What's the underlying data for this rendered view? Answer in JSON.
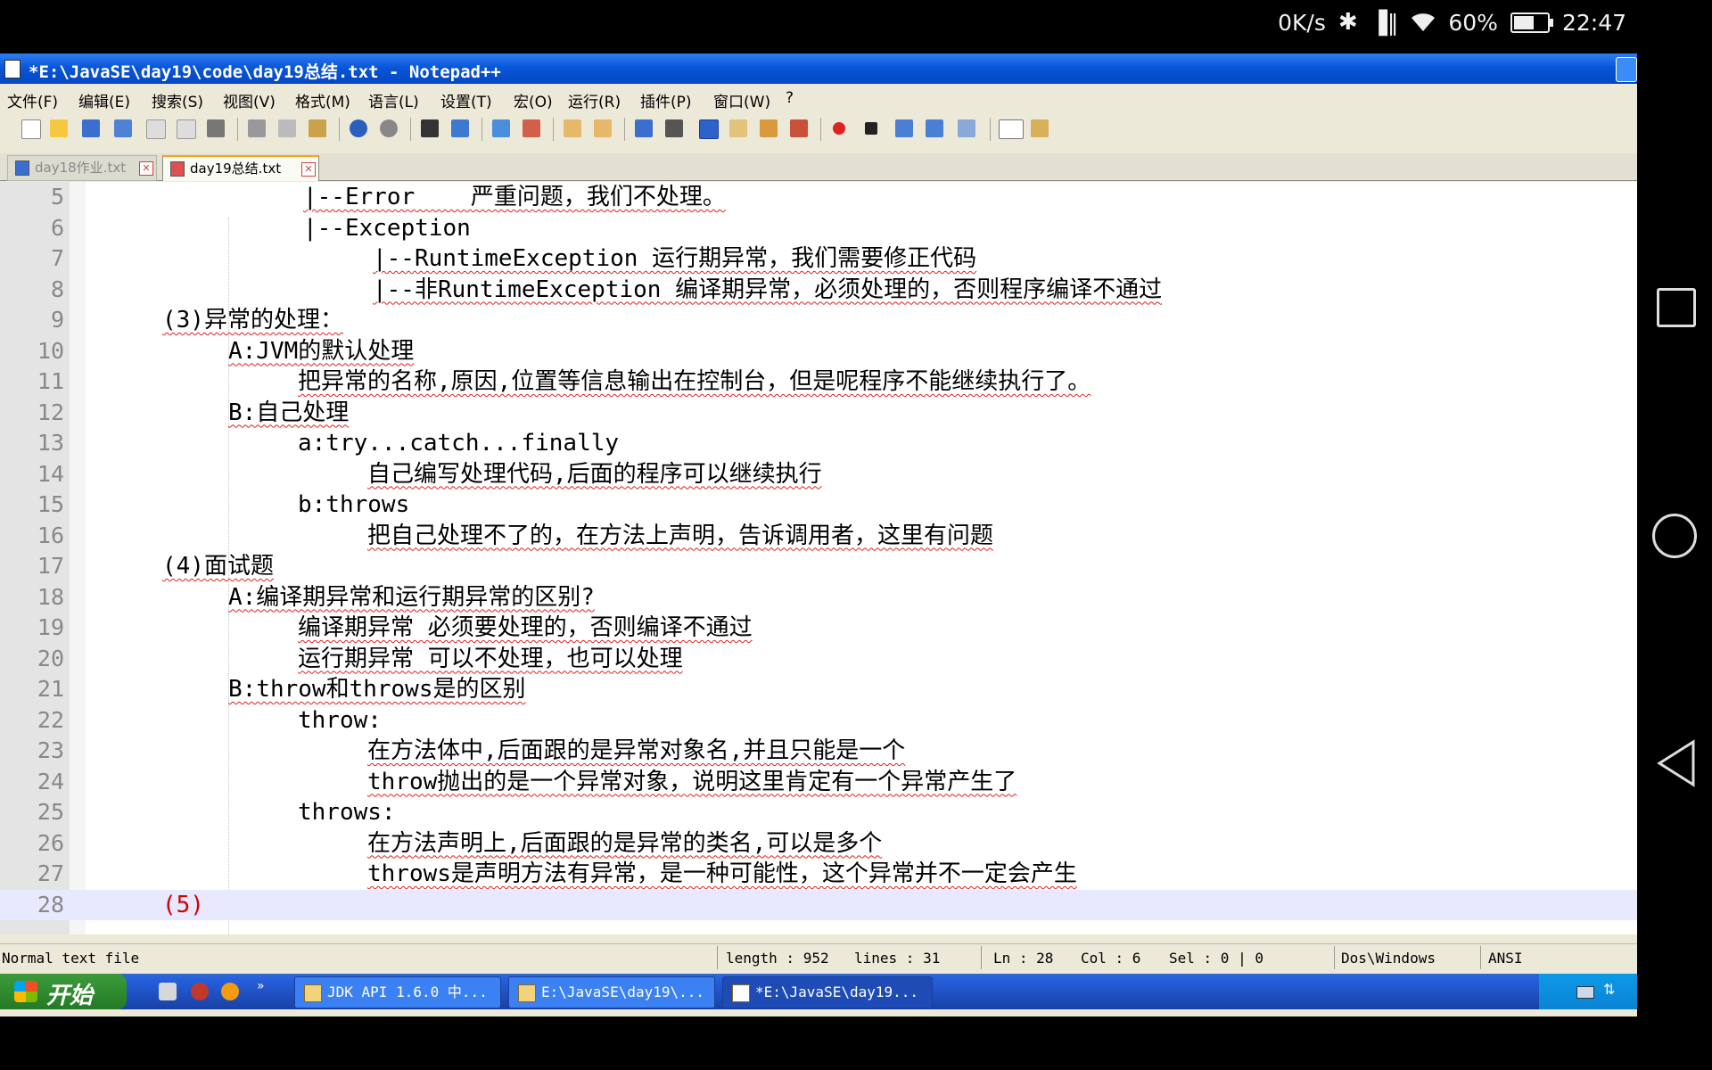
{
  "status_bar": {
    "speed": "0K/s",
    "battery": "60%",
    "battery_level": 0.6,
    "time": "22:47"
  },
  "window": {
    "title": "*E:\\JavaSE\\day19\\code\\day19总结.txt - Notepad++"
  },
  "menu": [
    "文件(F)",
    "编辑(E)",
    "搜索(S)",
    "视图(V)",
    "格式(M)",
    "语言(L)",
    "设置(T)",
    "宏(O)",
    "运行(R)",
    "插件(P)",
    "窗口(W)",
    "?"
  ],
  "tabs": [
    {
      "label": "day18作业.txt",
      "active": false
    },
    {
      "label": "day19总结.txt",
      "active": true
    }
  ],
  "editor": {
    "lines": [
      {
        "n": "5",
        "text": "|--Error    严重问题，我们不处理。"
      },
      {
        "n": "6",
        "text": "|--Exception"
      },
      {
        "n": "7",
        "text": "|--RuntimeException 运行期异常，我们需要修正代码"
      },
      {
        "n": "8",
        "text": "|--非RuntimeException 编译期异常，必须处理的，否则程序编译不通过"
      },
      {
        "n": "9",
        "text": "(3)异常的处理："
      },
      {
        "n": "10",
        "text": "A:JVM的默认处理"
      },
      {
        "n": "11",
        "text": "把异常的名称,原因,位置等信息输出在控制台，但是呢程序不能继续执行了。"
      },
      {
        "n": "12",
        "text": "B:自己处理"
      },
      {
        "n": "13",
        "text": "a:try...catch...finally"
      },
      {
        "n": "14",
        "text": "自己编写处理代码,后面的程序可以继续执行"
      },
      {
        "n": "15",
        "text": "b:throws"
      },
      {
        "n": "16",
        "text": "把自己处理不了的，在方法上声明，告诉调用者，这里有问题"
      },
      {
        "n": "17",
        "text": "(4)面试题"
      },
      {
        "n": "18",
        "text": "A:编译期异常和运行期异常的区别?"
      },
      {
        "n": "19",
        "text": "编译期异常 必须要处理的，否则编译不通过"
      },
      {
        "n": "20",
        "text": "运行期异常 可以不处理，也可以处理"
      },
      {
        "n": "21",
        "text": "B:throw和throws是的区别"
      },
      {
        "n": "22",
        "text": "throw:"
      },
      {
        "n": "23",
        "text": "在方法体中,后面跟的是异常对象名,并且只能是一个"
      },
      {
        "n": "24",
        "text": "throw抛出的是一个异常对象，说明这里肯定有一个异常产生了"
      },
      {
        "n": "25",
        "text": "throws:"
      },
      {
        "n": "26",
        "text": "在方法声明上,后面跟的是异常的类名,可以是多个"
      },
      {
        "n": "27",
        "text": "throws是声明方法有异常，是一种可能性，这个异常并不一定会产生"
      },
      {
        "n": "28",
        "text": "(5)"
      }
    ]
  },
  "statusbar": {
    "file_type": "Normal text file",
    "length": "length : 952",
    "lines": "lines : 31",
    "ln": "Ln : 28",
    "col": "Col : 6",
    "sel": "Sel : 0 | 0",
    "eol": "Dos\\Windows",
    "encoding": "ANSI"
  },
  "taskbar": {
    "start_label": "开始",
    "tasks": [
      "JDK API 1.6.0 中...",
      "E:\\JavaSE\\day19\\...",
      "*E:\\JavaSE\\day19..."
    ]
  }
}
